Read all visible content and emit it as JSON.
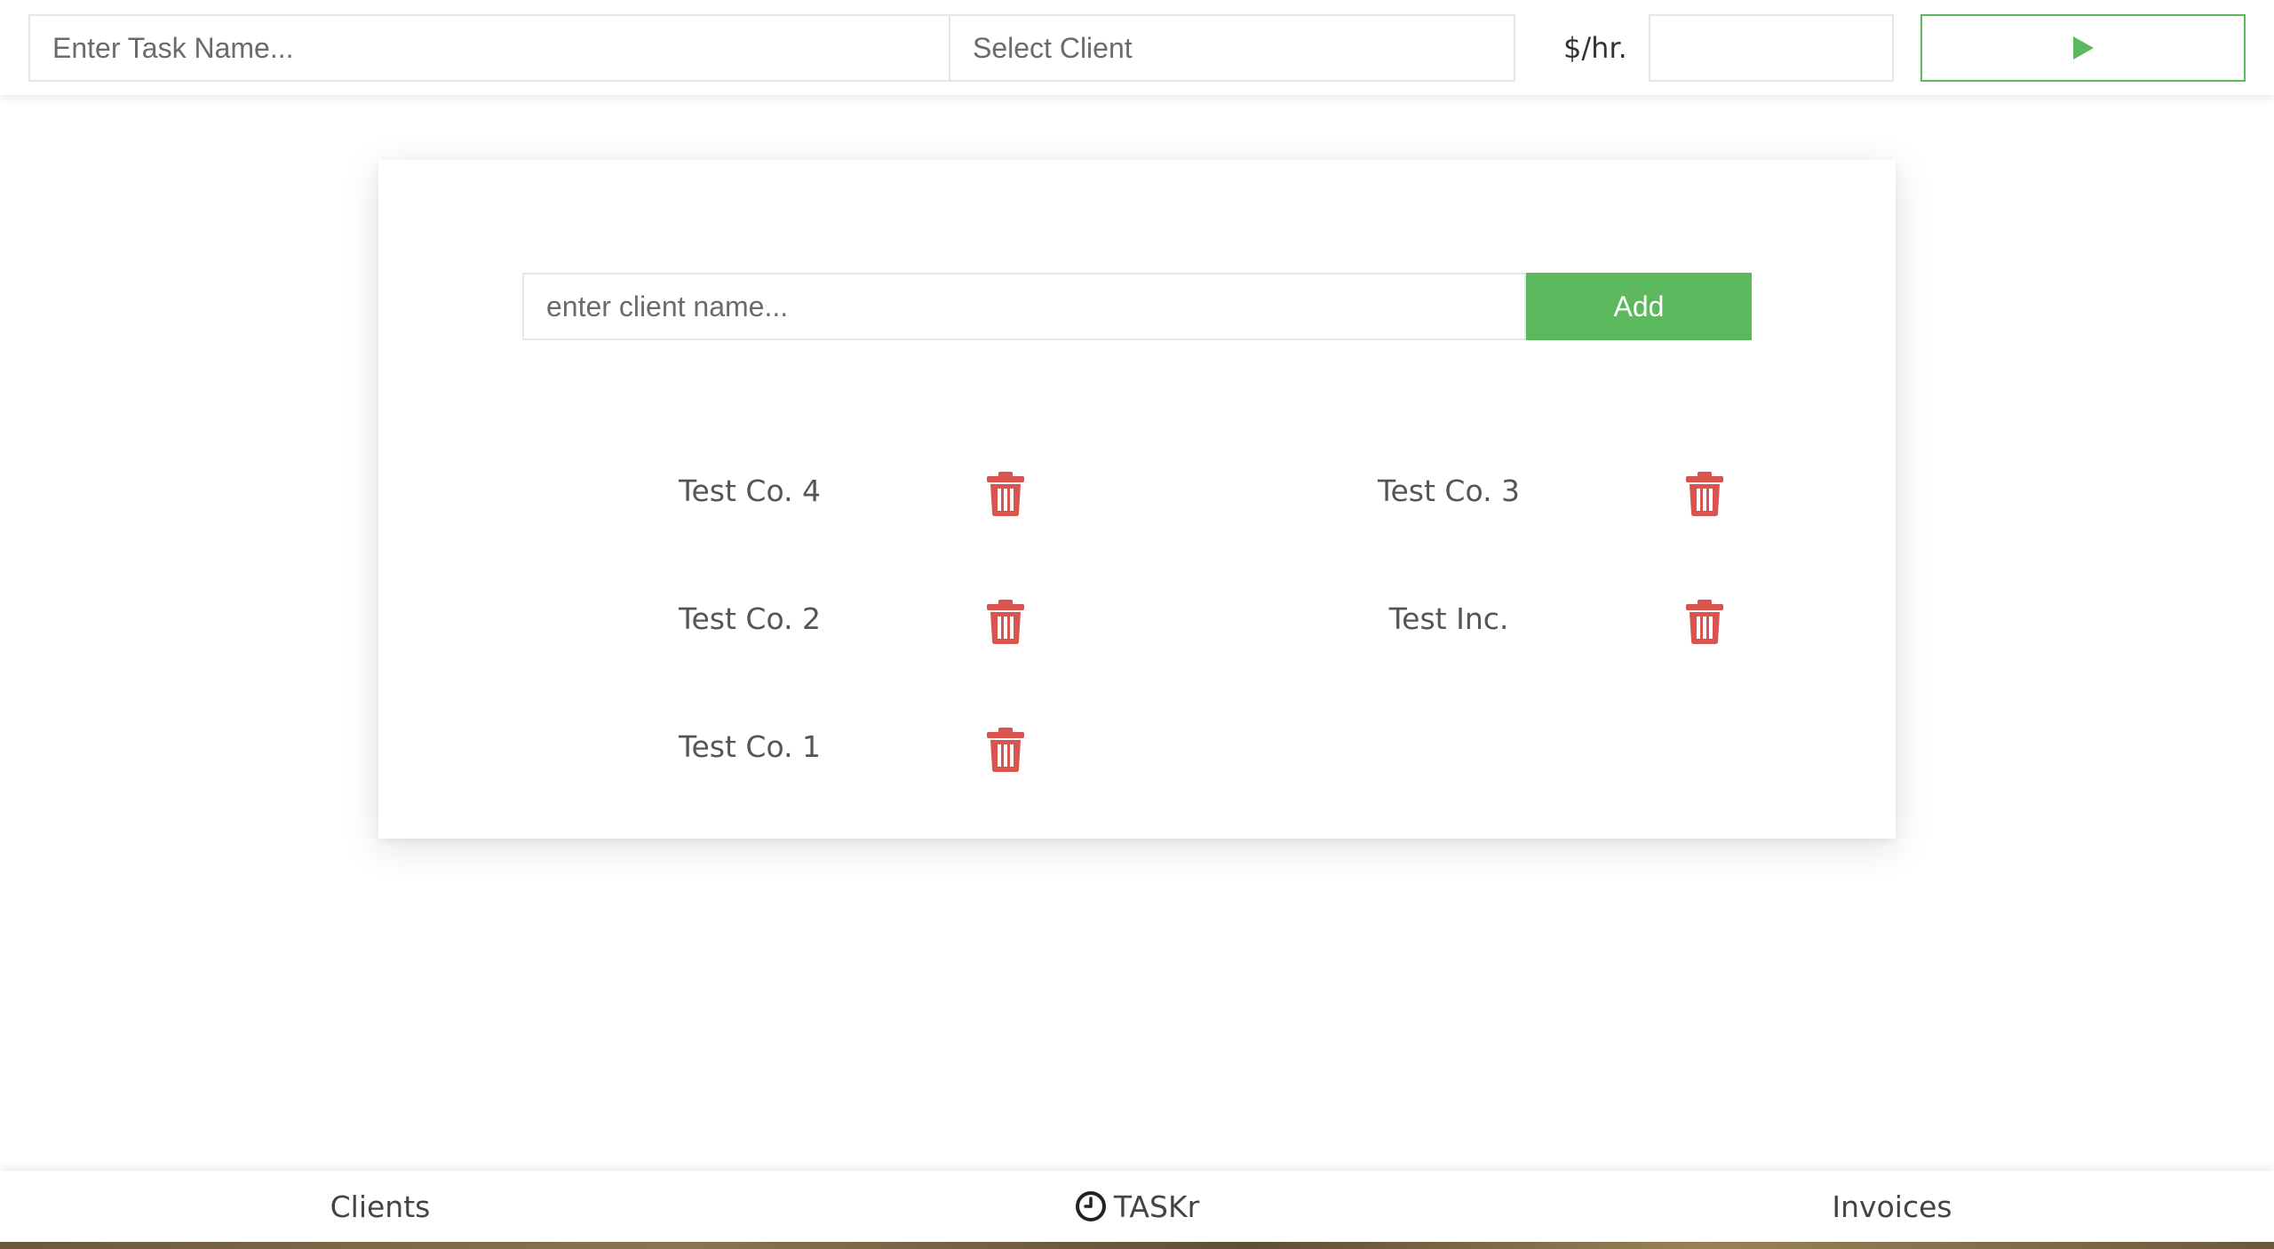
{
  "topbar": {
    "task_placeholder": "Enter Task Name...",
    "client_select_value": "Select Client",
    "rate_label": "$/hr.",
    "rate_value": "",
    "start_icon": "play-icon"
  },
  "client_form": {
    "placeholder": "enter client name...",
    "add_label": "Add"
  },
  "clients": [
    {
      "name": "Test Co. 4",
      "delete_icon": "trash-icon"
    },
    {
      "name": "Test Co. 3",
      "delete_icon": "trash-icon"
    },
    {
      "name": "Test Co. 2",
      "delete_icon": "trash-icon"
    },
    {
      "name": "Test Inc.",
      "delete_icon": "trash-icon"
    },
    {
      "name": "Test Co. 1",
      "delete_icon": "trash-icon"
    }
  ],
  "nav": {
    "clients_label": "Clients",
    "brand_label": "TASKr",
    "brand_icon": "clock-icon",
    "invoices_label": "Invoices"
  },
  "colors": {
    "accent_green": "#5cb85c",
    "delete_red": "#d9534f"
  }
}
